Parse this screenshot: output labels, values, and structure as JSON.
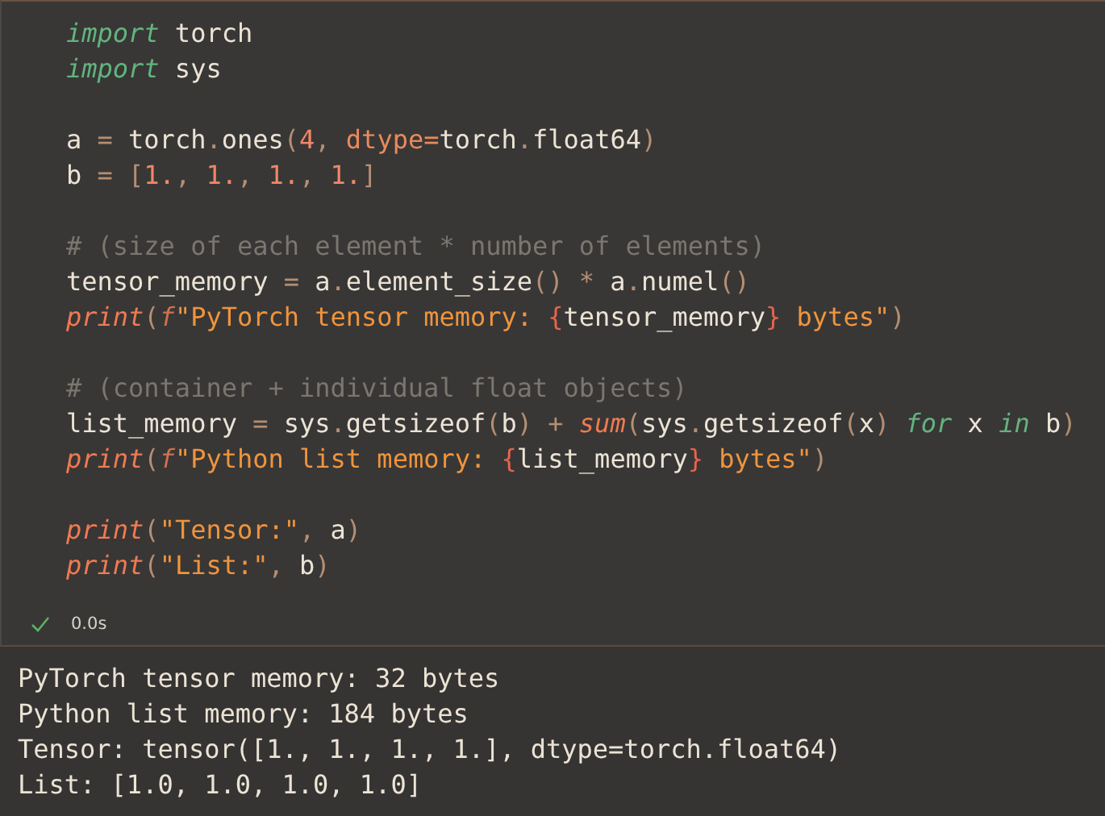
{
  "code_cell": {
    "lines": [
      {
        "kind": "code",
        "tokens": [
          {
            "kind": "kw",
            "text": "import"
          },
          {
            "kind": "plain",
            "text": " torch"
          }
        ]
      },
      {
        "kind": "code",
        "tokens": [
          {
            "kind": "kw",
            "text": "import"
          },
          {
            "kind": "plain",
            "text": " sys"
          }
        ]
      },
      {
        "kind": "blank"
      },
      {
        "kind": "code",
        "tokens": [
          {
            "kind": "plain",
            "text": "a "
          },
          {
            "kind": "op",
            "text": "="
          },
          {
            "kind": "plain",
            "text": " torch"
          },
          {
            "kind": "op",
            "text": "."
          },
          {
            "kind": "plain",
            "text": "ones"
          },
          {
            "kind": "op",
            "text": "("
          },
          {
            "kind": "num",
            "text": "4"
          },
          {
            "kind": "op",
            "text": ", "
          },
          {
            "kind": "param",
            "text": "dtype="
          },
          {
            "kind": "plain",
            "text": "torch"
          },
          {
            "kind": "op",
            "text": "."
          },
          {
            "kind": "plain",
            "text": "float64"
          },
          {
            "kind": "op",
            "text": ")"
          }
        ]
      },
      {
        "kind": "code",
        "tokens": [
          {
            "kind": "plain",
            "text": "b "
          },
          {
            "kind": "op",
            "text": "= ["
          },
          {
            "kind": "num",
            "text": "1."
          },
          {
            "kind": "op",
            "text": ", "
          },
          {
            "kind": "num",
            "text": "1."
          },
          {
            "kind": "op",
            "text": ", "
          },
          {
            "kind": "num",
            "text": "1."
          },
          {
            "kind": "op",
            "text": ", "
          },
          {
            "kind": "num",
            "text": "1."
          },
          {
            "kind": "op",
            "text": "]"
          }
        ]
      },
      {
        "kind": "blank"
      },
      {
        "kind": "code",
        "tokens": [
          {
            "kind": "comment",
            "text": "# (size of each element * number of elements)"
          }
        ]
      },
      {
        "kind": "code",
        "tokens": [
          {
            "kind": "plain",
            "text": "tensor_memory "
          },
          {
            "kind": "op",
            "text": "="
          },
          {
            "kind": "plain",
            "text": " a"
          },
          {
            "kind": "op",
            "text": "."
          },
          {
            "kind": "plain",
            "text": "element_size"
          },
          {
            "kind": "op",
            "text": "() * "
          },
          {
            "kind": "plain",
            "text": "a"
          },
          {
            "kind": "op",
            "text": "."
          },
          {
            "kind": "plain",
            "text": "numel"
          },
          {
            "kind": "op",
            "text": "()"
          }
        ]
      },
      {
        "kind": "code",
        "tokens": [
          {
            "kind": "fn",
            "text": "print"
          },
          {
            "kind": "op",
            "text": "("
          },
          {
            "kind": "prefix",
            "text": "f"
          },
          {
            "kind": "str",
            "text": "\"PyTorch tensor memory: "
          },
          {
            "kind": "brace",
            "text": "{"
          },
          {
            "kind": "plain",
            "text": "tensor_memory"
          },
          {
            "kind": "brace",
            "text": "}"
          },
          {
            "kind": "str",
            "text": " bytes\""
          },
          {
            "kind": "op",
            "text": ")"
          }
        ]
      },
      {
        "kind": "blank"
      },
      {
        "kind": "code",
        "tokens": [
          {
            "kind": "comment",
            "text": "# (container + individual float objects)"
          }
        ]
      },
      {
        "kind": "code",
        "tokens": [
          {
            "kind": "plain",
            "text": "list_memory "
          },
          {
            "kind": "op",
            "text": "="
          },
          {
            "kind": "plain",
            "text": " sys"
          },
          {
            "kind": "op",
            "text": "."
          },
          {
            "kind": "plain",
            "text": "getsizeof"
          },
          {
            "kind": "op",
            "text": "("
          },
          {
            "kind": "plain",
            "text": "b"
          },
          {
            "kind": "op",
            "text": ") + "
          },
          {
            "kind": "fn",
            "text": "sum"
          },
          {
            "kind": "op",
            "text": "("
          },
          {
            "kind": "plain",
            "text": "sys"
          },
          {
            "kind": "op",
            "text": "."
          },
          {
            "kind": "plain",
            "text": "getsizeof"
          },
          {
            "kind": "op",
            "text": "("
          },
          {
            "kind": "plain",
            "text": "x"
          },
          {
            "kind": "op",
            "text": ") "
          },
          {
            "kind": "kw",
            "text": "for"
          },
          {
            "kind": "plain",
            "text": " x "
          },
          {
            "kind": "kw",
            "text": "in"
          },
          {
            "kind": "plain",
            "text": " b"
          },
          {
            "kind": "op",
            "text": ")"
          }
        ]
      },
      {
        "kind": "code",
        "tokens": [
          {
            "kind": "fn",
            "text": "print"
          },
          {
            "kind": "op",
            "text": "("
          },
          {
            "kind": "prefix",
            "text": "f"
          },
          {
            "kind": "str",
            "text": "\"Python list memory: "
          },
          {
            "kind": "brace",
            "text": "{"
          },
          {
            "kind": "plain",
            "text": "list_memory"
          },
          {
            "kind": "brace",
            "text": "}"
          },
          {
            "kind": "str",
            "text": " bytes\""
          },
          {
            "kind": "op",
            "text": ")"
          }
        ]
      },
      {
        "kind": "blank"
      },
      {
        "kind": "code",
        "tokens": [
          {
            "kind": "fn",
            "text": "print"
          },
          {
            "kind": "op",
            "text": "("
          },
          {
            "kind": "str",
            "text": "\"Tensor:\""
          },
          {
            "kind": "op",
            "text": ", "
          },
          {
            "kind": "plain",
            "text": "a"
          },
          {
            "kind": "op",
            "text": ")"
          }
        ]
      },
      {
        "kind": "code",
        "tokens": [
          {
            "kind": "fn",
            "text": "print"
          },
          {
            "kind": "op",
            "text": "("
          },
          {
            "kind": "str",
            "text": "\"List:\""
          },
          {
            "kind": "op",
            "text": ", "
          },
          {
            "kind": "plain",
            "text": "b"
          },
          {
            "kind": "op",
            "text": ")"
          }
        ]
      }
    ],
    "status": {
      "succeeded": true,
      "duration": "0.0s"
    }
  },
  "output": {
    "lines": [
      "PyTorch tensor memory: 32 bytes",
      "Python list memory: 184 bytes",
      "Tensor: tensor([1., 1., 1., 1.], dtype=torch.float64)",
      "List: [1.0, 1.0, 1.0, 1.0]"
    ]
  }
}
